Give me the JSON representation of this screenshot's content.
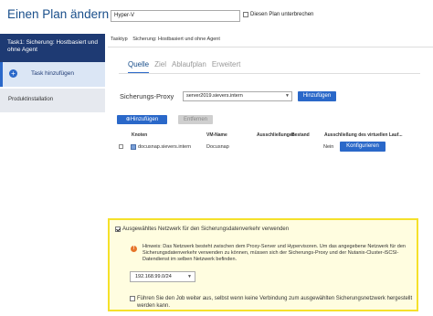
{
  "header": {
    "title": "Einen Plan ändern",
    "plan_name": "Hyper-V",
    "pause_label": "Diesen Plan unterbrechen"
  },
  "sidebar": {
    "task_title": "Task1: Sicherung: Hostbasiert und ohne Agent",
    "add_task": "Task hinzufügen",
    "product_install": "Produktinstallation"
  },
  "tasktype": {
    "label": "Tasktyp",
    "value": "Sicherung: Hostbasiert und ohne Agent"
  },
  "tabs": [
    {
      "label": "Quelle",
      "active": true
    },
    {
      "label": "Ziel",
      "active": false
    },
    {
      "label": "Ablaufplan",
      "active": false
    },
    {
      "label": "Erweitert",
      "active": false
    }
  ],
  "proxy": {
    "label": "Sicherungs-Proxy",
    "selected": "server2019.sievers.intern",
    "add_button": "Hinzufügen"
  },
  "node_actions": {
    "add": "Hinzufügen",
    "remove": "Entfernen"
  },
  "table": {
    "columns": [
      "Knoten",
      "VM-Name",
      "Ausschließungen",
      "Bestand",
      "Ausschließung des virtuellen Lauf..."
    ],
    "rows": [
      {
        "node": "docusnap.sievers.intern",
        "vm": "Docusnap",
        "exclusions": "",
        "inventory": "",
        "disk_exclusion": "Nein",
        "action": "Konfigurieren"
      }
    ]
  },
  "network_panel": {
    "use_network_label": "Ausgewähltes Netzwerk für den Sicherungsdatenverkehr verwenden",
    "hint": "Hinweis: Das Netzwerk besteht zwischen dem Proxy-Server und Hypervisoren. Um das angegebene Netzwerk für den Sicherungsdatenverkehr verwenden zu können, müssen sich der Sicherungs-Proxy und der Nutanix-Cluster-iSCSI-Datendienst im selben Netzwerk befinden.",
    "network_value": "192.168.99.0/24",
    "fallback_label": "Führen Sie den Job weiter aus, selbst wenn keine Verbindung zum ausgewählten Sicherungsnetzwerk hergestellt werden kann."
  },
  "colors": {
    "nav_dark": "#1e3a73",
    "accent": "#2a68c9",
    "highlight_border": "#f5e12a",
    "hint_icon": "#e6752a"
  }
}
